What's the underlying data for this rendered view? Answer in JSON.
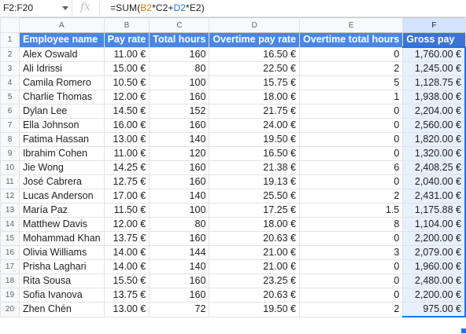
{
  "formula_bar": {
    "cell_ref": "F2:F20",
    "fx": "fx",
    "formula_parts": [
      "=SUM(",
      "B2",
      "*",
      "C2",
      "+",
      "D2",
      "*",
      "E2",
      ")"
    ]
  },
  "columns": [
    "A",
    "B",
    "C",
    "D",
    "E",
    "F"
  ],
  "header_row": {
    "row_number": "1",
    "cells": [
      "Employee name",
      "Pay rate",
      "Total hours",
      "Overtime pay rate",
      "Overtime total hours",
      "Gross pay"
    ]
  },
  "rows": [
    {
      "n": "2",
      "cells": [
        "Alex Oswald",
        "11.00 €",
        "160",
        "16.50 €",
        "0",
        "1,760.00 €"
      ]
    },
    {
      "n": "3",
      "cells": [
        "Ali Idrissi",
        "15.00 €",
        "80",
        "22.50 €",
        "2",
        "1,245.00 €"
      ]
    },
    {
      "n": "4",
      "cells": [
        "Camila Romero",
        "10.50 €",
        "100",
        "15.75 €",
        "5",
        "1,128.75 €"
      ]
    },
    {
      "n": "5",
      "cells": [
        "Charlie Thomas",
        "12.00 €",
        "160",
        "18.00 €",
        "1",
        "1,938.00 €"
      ]
    },
    {
      "n": "6",
      "cells": [
        "Dylan Lee",
        "14.50 €",
        "152",
        "21.75 €",
        "0",
        "2,204.00 €"
      ]
    },
    {
      "n": "7",
      "cells": [
        "Ella Johnson",
        "16.00 €",
        "160",
        "24.00 €",
        "0",
        "2,560.00 €"
      ]
    },
    {
      "n": "8",
      "cells": [
        "Fatima Hassan",
        "13.00 €",
        "140",
        "19.50 €",
        "0",
        "1,820.00 €"
      ]
    },
    {
      "n": "9",
      "cells": [
        "Ibrahim Cohen",
        "11.00 €",
        "120",
        "16.50 €",
        "0",
        "1,320.00 €"
      ]
    },
    {
      "n": "10",
      "cells": [
        "Jie Wong",
        "14.25 €",
        "160",
        "21.38 €",
        "6",
        "2,408.25 €"
      ]
    },
    {
      "n": "11",
      "cells": [
        "José Cabrera",
        "12.75 €",
        "160",
        "19.13 €",
        "0",
        "2,040.00 €"
      ]
    },
    {
      "n": "12",
      "cells": [
        "Lucas Anderson",
        "17.00 €",
        "140",
        "25.50 €",
        "2",
        "2,431.00 €"
      ]
    },
    {
      "n": "13",
      "cells": [
        "María Paz",
        "11.50 €",
        "100",
        "17.25 €",
        "1.5",
        "1,175.88 €"
      ]
    },
    {
      "n": "14",
      "cells": [
        "Matthew Davis",
        "12.00 €",
        "80",
        "18.00 €",
        "8",
        "1,104.00 €"
      ]
    },
    {
      "n": "15",
      "cells": [
        "Mohammad Khan",
        "13.75 €",
        "160",
        "20.63 €",
        "0",
        "2,200.00 €"
      ]
    },
    {
      "n": "16",
      "cells": [
        "Olivia Williams",
        "14.00 €",
        "144",
        "21.00 €",
        "3",
        "2,079.00 €"
      ]
    },
    {
      "n": "17",
      "cells": [
        "Prisha Laghari",
        "14.00 €",
        "140",
        "21.00 €",
        "0",
        "1,960.00 €"
      ]
    },
    {
      "n": "18",
      "cells": [
        "Rita Sousa",
        "15.50 €",
        "160",
        "23.25 €",
        "0",
        "2,480.00 €"
      ]
    },
    {
      "n": "19",
      "cells": [
        "Sofia Ivanova",
        "13.75 €",
        "160",
        "20.63 €",
        "0",
        "2,200.00 €"
      ]
    },
    {
      "n": "20",
      "cells": [
        "Zhen Chén",
        "13.00 €",
        "72",
        "19.50 €",
        "2",
        "975.00 €"
      ]
    }
  ],
  "selected_column": "F",
  "colors": {
    "header_fill": "#4a86e8",
    "selection_border": "#1a73e8",
    "selection_fill": "#e8f0fe"
  }
}
